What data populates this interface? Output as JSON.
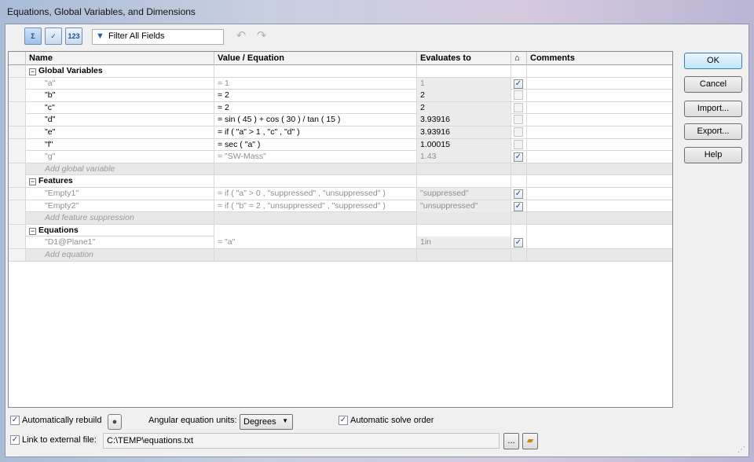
{
  "window": {
    "title": "Equations, Global Variables, and Dimensions"
  },
  "toolbar": {
    "btn1_label": "Σ",
    "btn2_label": "✓",
    "btn3_label": "123",
    "filter_placeholder": "Filter All Fields",
    "icons": [
      "equation-view-icon",
      "sketch-equation-view-icon",
      "ordered-view-icon",
      "filter-icon",
      "undo-icon",
      "redo-icon"
    ]
  },
  "grid": {
    "columns": [
      "Name",
      "Value / Equation",
      "Evaluates to",
      "",
      "Comments"
    ],
    "groups": {
      "global": {
        "label": "Global Variables",
        "rows": [
          {
            "name": "\"a\"",
            "value": "= 1",
            "eval": "1",
            "checked": true,
            "muted": true
          },
          {
            "name": "\"b\"",
            "value": "= 2",
            "eval": "2",
            "checked": false,
            "muted": false
          },
          {
            "name": "\"c\"",
            "value": "= 2",
            "eval": "2",
            "checked": false,
            "muted": false
          },
          {
            "name": "\"d\"",
            "value": "= sin ( 45 ) + cos ( 30 ) / tan ( 15 )",
            "eval": "3.93916",
            "checked": false,
            "muted": false
          },
          {
            "name": "\"e\"",
            "value": "= if ( \"a\" > 1 , \"c\" , \"d\" )",
            "eval": "3.93916",
            "checked": false,
            "muted": false
          },
          {
            "name": "\"f\"",
            "value": "= sec ( \"a\" )",
            "eval": "1.00015",
            "checked": false,
            "muted": false
          },
          {
            "name": "\"g\"",
            "value": "= \"SW-Mass\"",
            "eval": "1.43",
            "checked": true,
            "muted": true
          }
        ],
        "add": "Add global variable"
      },
      "features": {
        "label": "Features",
        "rows": [
          {
            "name": "\"Empty1\"",
            "value": "= if ( \"a\" > 0 , \"suppressed\" , \"unsuppressed\" )",
            "eval": "\"suppressed\"",
            "checked": true,
            "muted": true
          },
          {
            "name": "\"Empty2\"",
            "value": "= if ( \"b\" = 2 , \"unsuppressed\" , \"suppressed\" )",
            "eval": "\"unsuppressed\"",
            "checked": true,
            "muted": true
          }
        ],
        "add": "Add feature suppression"
      },
      "equations": {
        "label": "Equations",
        "rows": [
          {
            "name": "\"D1@Plane1\"",
            "value": "= \"a\"",
            "eval": "1in",
            "checked": true,
            "muted": true
          }
        ],
        "add": "Add equation"
      }
    }
  },
  "buttons": {
    "ok": "OK",
    "cancel": "Cancel",
    "import": "Import...",
    "export": "Export...",
    "help": "Help"
  },
  "bottom": {
    "auto_rebuild": "Automatically rebuild",
    "angular_label": "Angular equation units:",
    "angular_value": "Degrees",
    "auto_solve": "Automatic solve order",
    "link_label": "Link to external file:",
    "link_path": "C:\\TEMP\\equations.txt",
    "browse": "...",
    "check_mark": "✓"
  }
}
